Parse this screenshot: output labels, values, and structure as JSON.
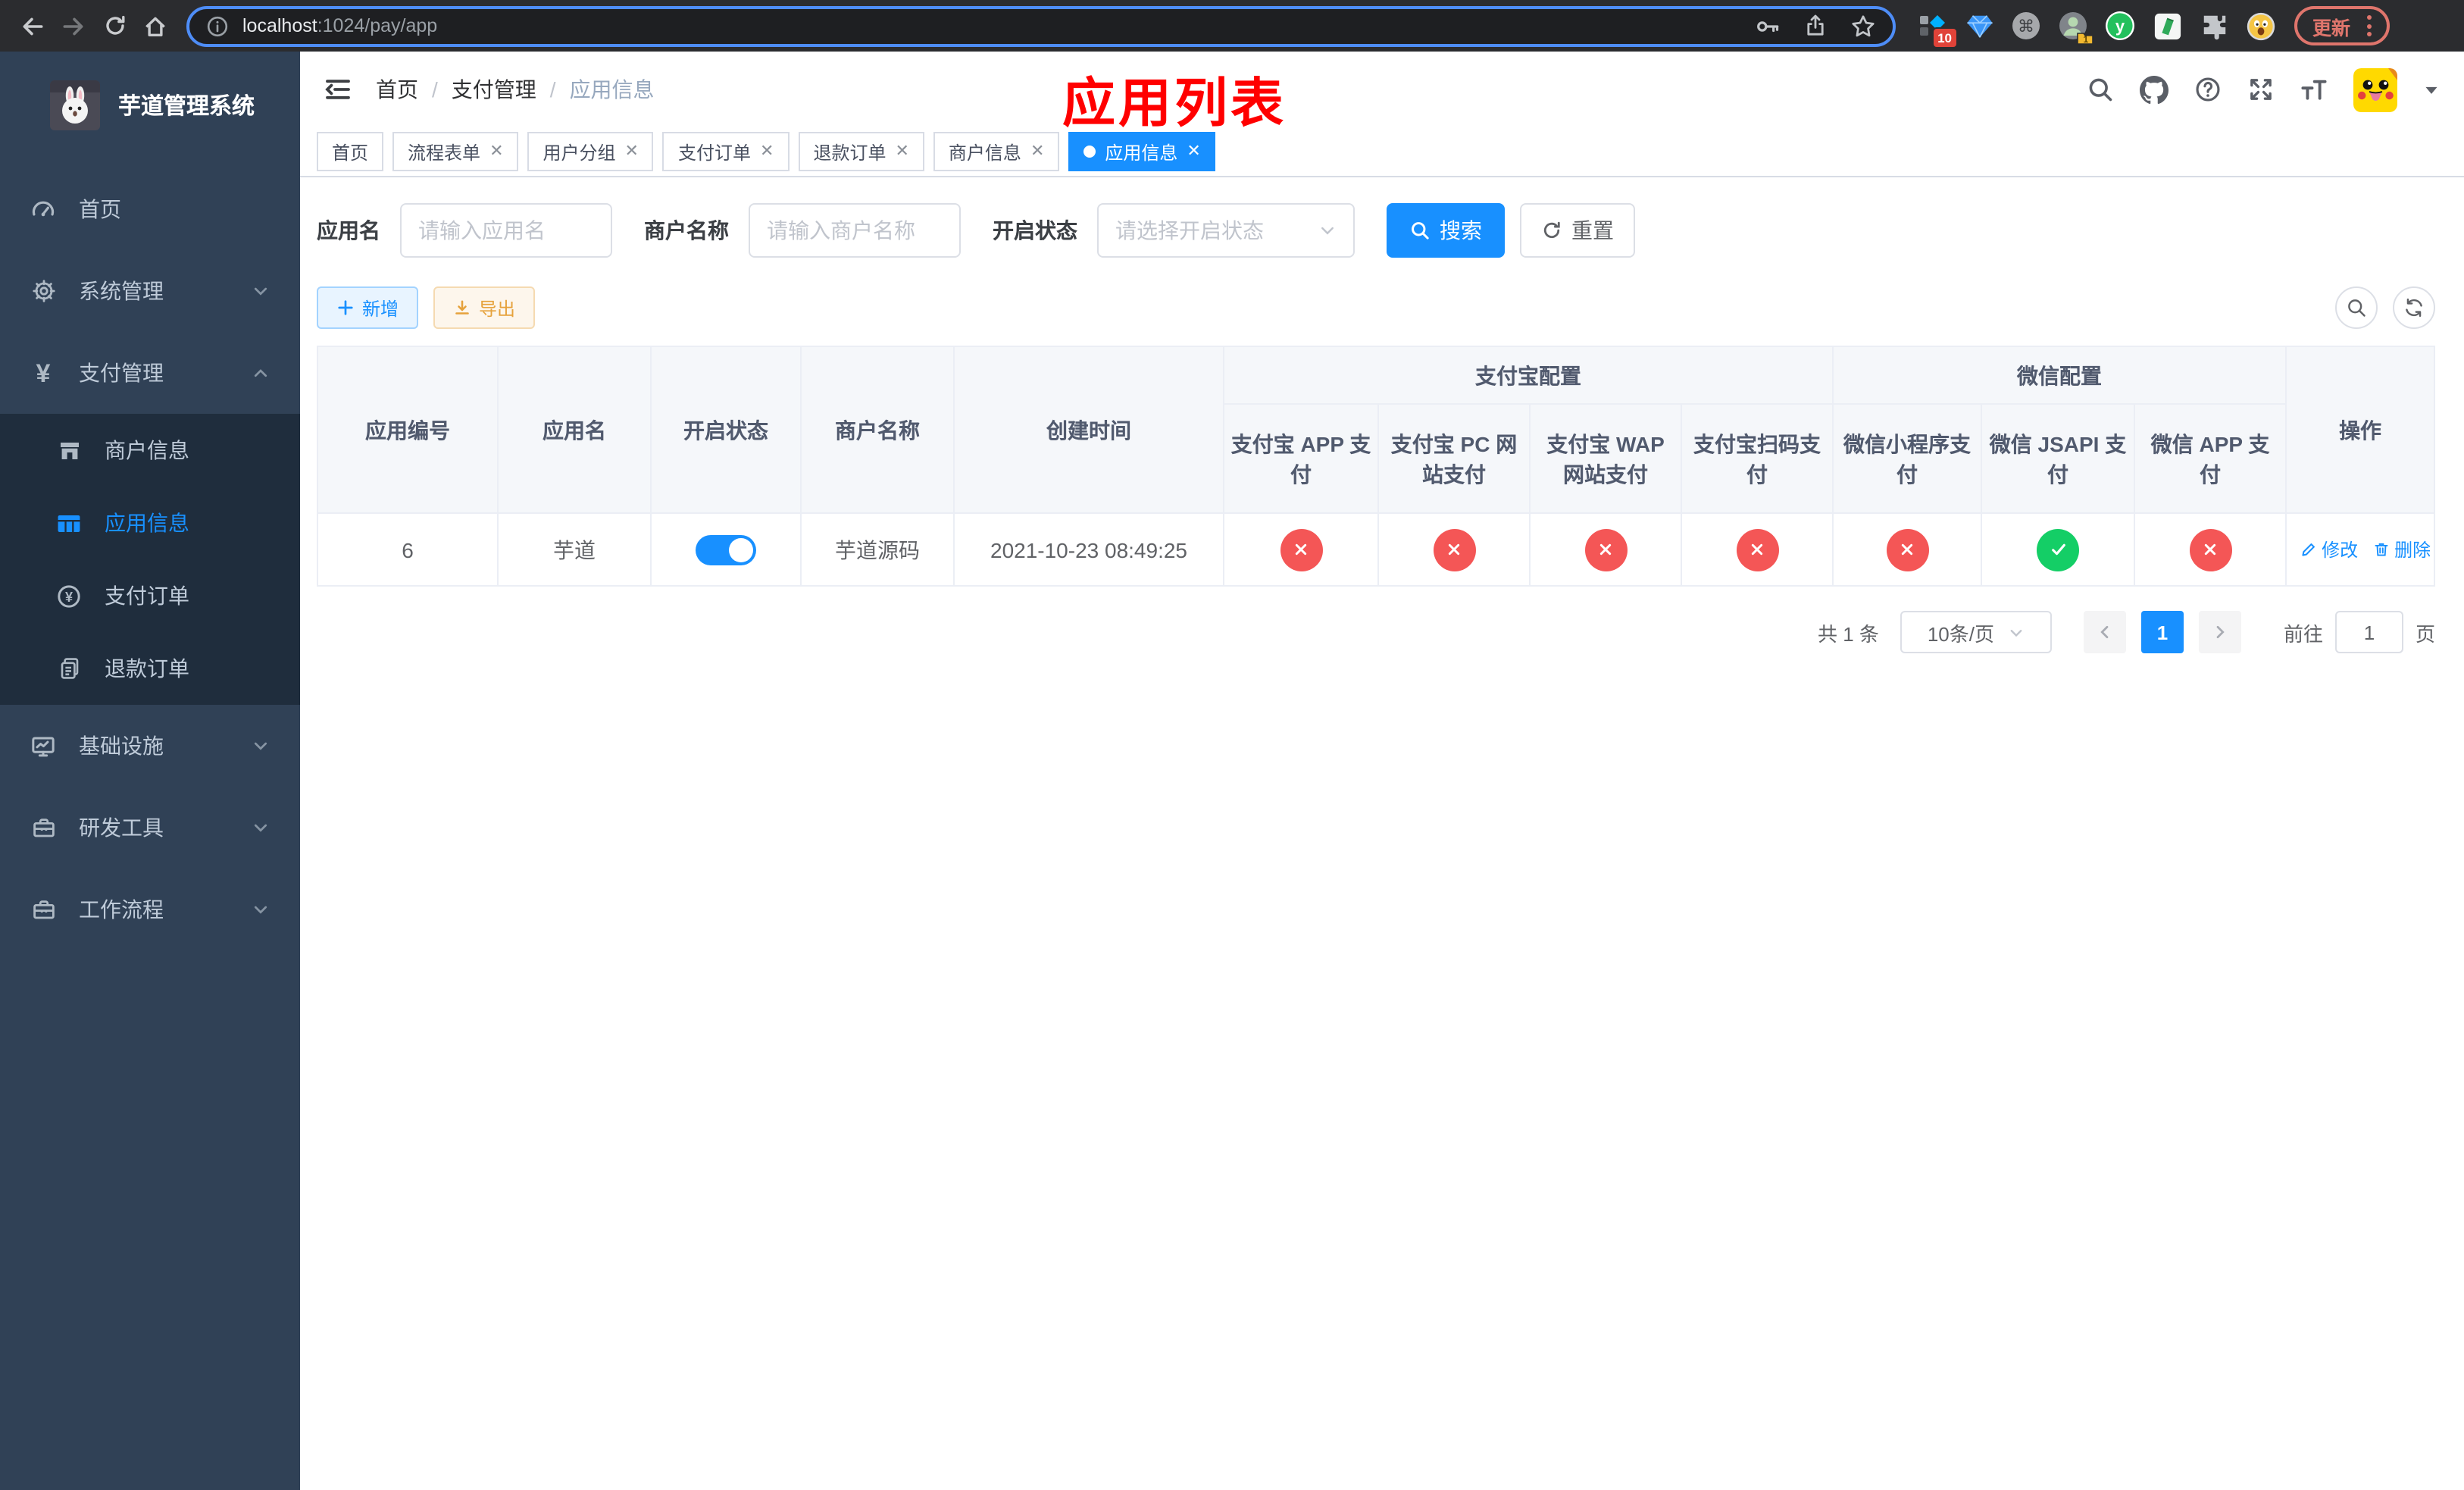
{
  "colors": {
    "primary": "#1890ff",
    "success": "#14ce66",
    "danger": "#f45656",
    "warning": "#e6a23c",
    "annotation_red": "#ff0000",
    "sidebar_bg": "#304156",
    "sidebar_submenu_bg": "#1f2d3d"
  },
  "browser": {
    "url_host": "localhost",
    "url_rest": ":1024/pay/app",
    "extension_badge": "10",
    "profile_badge": "1",
    "update_label": "更新"
  },
  "sidebar": {
    "app_title": "芋道管理系统",
    "menu": [
      {
        "label": "首页"
      },
      {
        "label": "系统管理"
      },
      {
        "label": "支付管理"
      }
    ],
    "submenu": [
      {
        "label": "商户信息",
        "active": false
      },
      {
        "label": "应用信息",
        "active": true
      },
      {
        "label": "支付订单",
        "active": false
      },
      {
        "label": "退款订单",
        "active": false
      }
    ],
    "menu_bottom": [
      {
        "label": "基础设施"
      },
      {
        "label": "研发工具"
      },
      {
        "label": "工作流程"
      }
    ]
  },
  "breadcrumb": {
    "items": [
      "首页",
      "支付管理",
      "应用信息"
    ]
  },
  "annotation": {
    "title": "应用列表"
  },
  "tabs": {
    "items": [
      {
        "label": "首页",
        "closable": false,
        "active": false
      },
      {
        "label": "流程表单",
        "closable": true,
        "active": false
      },
      {
        "label": "用户分组",
        "closable": true,
        "active": false
      },
      {
        "label": "支付订单",
        "closable": true,
        "active": false
      },
      {
        "label": "退款订单",
        "closable": true,
        "active": false
      },
      {
        "label": "商户信息",
        "closable": true,
        "active": false
      },
      {
        "label": "应用信息",
        "closable": true,
        "active": true
      }
    ]
  },
  "filters": {
    "app_name_label": "应用名",
    "app_name_placeholder": "请输入应用名",
    "merchant_label": "商户名称",
    "merchant_placeholder": "请输入商户名称",
    "status_label": "开启状态",
    "status_placeholder": "请选择开启状态",
    "search_label": "搜索",
    "reset_label": "重置"
  },
  "toolbar": {
    "add_label": "新增",
    "export_label": "导出"
  },
  "table": {
    "columns": {
      "app_id": "应用编号",
      "app_name": "应用名",
      "status": "开启状态",
      "merchant": "商户名称",
      "created": "创建时间",
      "ops": "操作"
    },
    "groups": {
      "alipay": "支付宝配置",
      "wechat": "微信配置"
    },
    "sub_columns": [
      "支付宝 APP 支付",
      "支付宝 PC 网站支付",
      "支付宝 WAP 网站支付",
      "支付宝扫码支付",
      "微信小程序支付",
      "微信 JSAPI 支付",
      "微信 APP 支付"
    ],
    "row": {
      "app_id": "6",
      "app_name": "芋道",
      "enabled": true,
      "merchant": "芋道源码",
      "created": "2021-10-23 08:49:25",
      "channel_enabled": [
        false,
        false,
        false,
        false,
        false,
        true,
        false
      ],
      "edit_label": "修改",
      "delete_label": "删除"
    }
  },
  "pagination": {
    "total_label": "共 1 条",
    "page_size_label": "10条/页",
    "current_page": "1",
    "goto_label": "前往",
    "goto_value": "1",
    "page_unit": "页"
  }
}
